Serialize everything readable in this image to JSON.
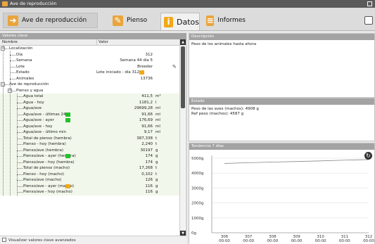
{
  "window": {
    "title": "Ave de reproducción"
  },
  "tabs": [
    {
      "label": "Ave de reproducción",
      "icon": "bird-icon",
      "color": "#e9a53c"
    },
    {
      "label": "Pienso",
      "icon": "feed-icon",
      "color": "#e9a53c"
    },
    {
      "label": "Datos",
      "icon": "info-icon",
      "color": "#f0a81a"
    },
    {
      "label": "Informes",
      "icon": "report-icon",
      "color": "#e9a53c"
    }
  ],
  "left_panel": {
    "header": "Valores clave",
    "col_name": "Nombre",
    "col_value": "Valor",
    "footer_checkbox": "Visualizar valores clave avanzados",
    "rows": [
      {
        "label": "Localización",
        "value": "",
        "unit": "",
        "level": 1,
        "group": true
      },
      {
        "label": "Día",
        "value": "312",
        "unit": "",
        "level": 2
      },
      {
        "label": "Semana",
        "value": "Semana 44 día 5",
        "unit": "",
        "level": 2
      },
      {
        "label": "Lote",
        "value": "Breeder",
        "unit": "",
        "level": 2,
        "pencil": true
      },
      {
        "label": "Estado",
        "value": "Lote iniciado - día 312",
        "unit": "",
        "level": 2,
        "indicator": "#f0a81a"
      },
      {
        "label": "Animales",
        "value": "13736",
        "unit": "",
        "level": 2
      },
      {
        "label": "Ave de reproducción",
        "value": "",
        "unit": "",
        "level": 1,
        "group": true
      },
      {
        "label": "Pienso y agua",
        "value": "",
        "unit": "",
        "level": 2,
        "group": true
      },
      {
        "label": "Agua total",
        "value": "411,5",
        "unit": "m³",
        "level": 3
      },
      {
        "label": "Agua - hoy",
        "value": "1181,2",
        "unit": "l",
        "level": 3
      },
      {
        "label": "Agua/ave",
        "value": "29699,28",
        "unit": "ml",
        "level": 3
      },
      {
        "label": "Agua/ave - últimas 24h",
        "value": "91,66",
        "unit": "ml",
        "level": 3,
        "indicator": "#22c02a"
      },
      {
        "label": "Agua/ave - ayer",
        "value": "176,69",
        "unit": "ml",
        "level": 3,
        "indicator": "#22c02a"
      },
      {
        "label": "Agua/ave - hoy",
        "value": "91,66",
        "unit": "ml",
        "level": 3
      },
      {
        "label": "Agua/ave - último min",
        "value": "9,17",
        "unit": "ml",
        "level": 3
      },
      {
        "label": "Total de pienso (hembra)",
        "value": "387,338",
        "unit": "t",
        "level": 3
      },
      {
        "label": "Pienso - hoy (hembra)",
        "value": "2,240",
        "unit": "t",
        "level": 3
      },
      {
        "label": "Pienso/ave (hembra)",
        "value": "30197",
        "unit": "g",
        "level": 3
      },
      {
        "label": "Pienso/ave - ayer (hembra)",
        "value": "174",
        "unit": "g",
        "level": 3,
        "indicator": "#22c02a"
      },
      {
        "label": "Pienso/ave - hoy (hembra)",
        "value": "174",
        "unit": "g",
        "level": 3
      },
      {
        "label": "Total de pienso (macho)",
        "value": "17,268",
        "unit": "t",
        "level": 3
      },
      {
        "label": "Pienso - hoy (macho)",
        "value": "0,102",
        "unit": "t",
        "level": 3
      },
      {
        "label": "Pienso/ave (macho)",
        "value": "126",
        "unit": "g",
        "level": 3
      },
      {
        "label": "Pienso/ave - ayer (macho)",
        "value": "116",
        "unit": "g",
        "level": 3,
        "indicator": "#f0a81a"
      },
      {
        "label": "Pienso/ave - hoy (macho)",
        "value": "116",
        "unit": "g",
        "level": 3
      }
    ]
  },
  "descripcion": {
    "header": "Descripción",
    "text": "Peso de los animales hasta ahora"
  },
  "estado": {
    "header": "Estado",
    "line1": "Peso de las aves (machos): 4908 g",
    "line2": "Ref peso (machos): 4587 g"
  },
  "tendencia": {
    "header": "Tendencia 7 días"
  },
  "chart_data": {
    "type": "line",
    "title": "Tendencia 7 días",
    "x": [
      "306\n00:00",
      "307\n00:00",
      "308\n00:00",
      "309\n00:00",
      "310\n00:00",
      "311\n00:00",
      "312\n00:00"
    ],
    "x_ticks": [
      {
        "day": "306",
        "time": "00:00"
      },
      {
        "day": "307",
        "time": "00:00"
      },
      {
        "day": "308",
        "time": "00:00"
      },
      {
        "day": "309",
        "time": "00:00"
      },
      {
        "day": "310",
        "time": "00:00"
      },
      {
        "day": "311",
        "time": "00:00"
      },
      {
        "day": "312",
        "time": "00:00"
      }
    ],
    "y_ticks": [
      "5000g",
      "4000g",
      "3000g",
      "2000g",
      "1000g",
      "0g"
    ],
    "ylim": [
      0,
      5000
    ],
    "series": [
      {
        "values": [
          4650,
          4700,
          4740,
          4780,
          4820,
          4870,
          4908
        ],
        "color": "#888888"
      }
    ],
    "grid": true
  }
}
